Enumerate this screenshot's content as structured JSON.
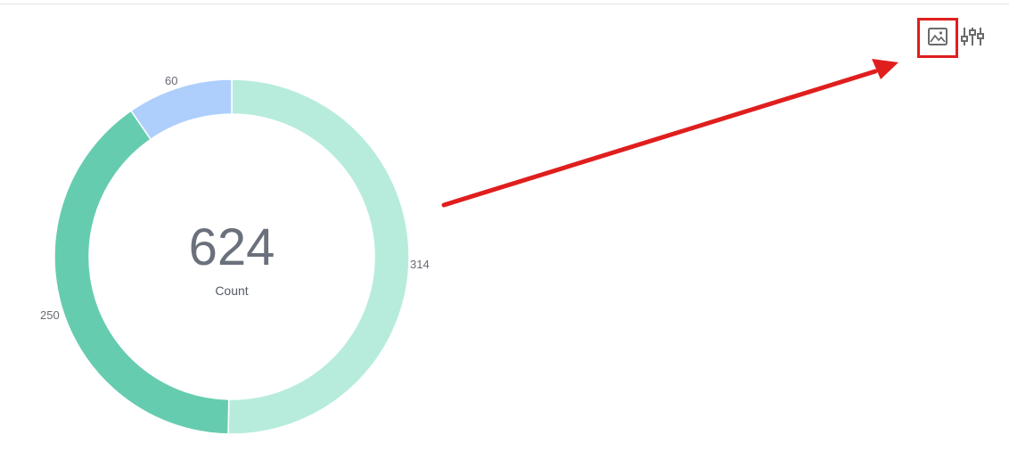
{
  "toolbar": {
    "image_icon": "image-icon",
    "settings_icon": "sliders-icon"
  },
  "donut": {
    "center_value": "624",
    "center_label": "Count"
  },
  "chart_data": {
    "type": "pie",
    "donut": true,
    "total": 624,
    "slices": [
      {
        "label": "314",
        "value": 314,
        "color": "#b7ecdd"
      },
      {
        "label": "250",
        "value": 250,
        "color": "#66ccb0"
      },
      {
        "label": "60",
        "value": 60,
        "color": "#aecffc"
      }
    ]
  },
  "annotation": {
    "arrow_color": "#e01e1e",
    "highlight_color": "#e01e1e"
  }
}
